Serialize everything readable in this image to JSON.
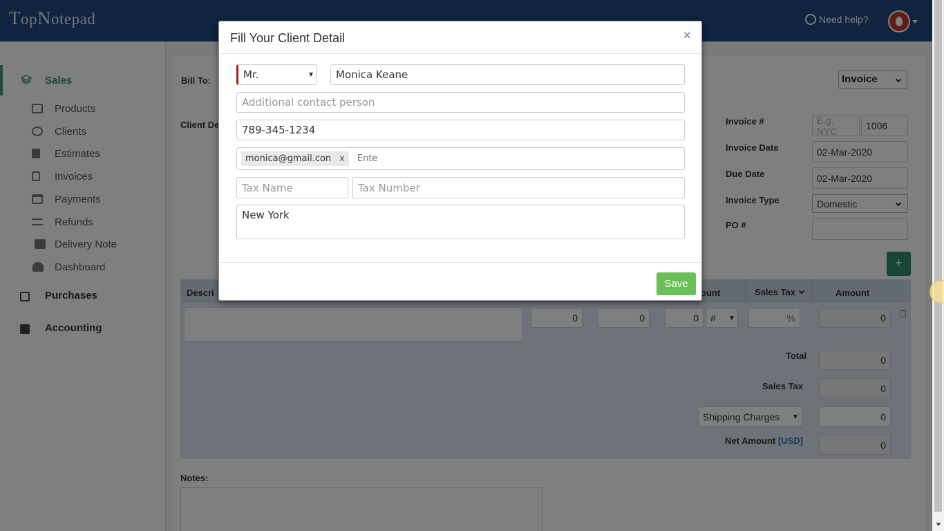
{
  "header": {
    "logo_big": "T",
    "logo_rest": "op",
    "logo_big2": "N",
    "logo_rest2": "otepad",
    "help": "Need help?"
  },
  "sidebar": {
    "sales": "Sales",
    "items": [
      {
        "label": "Products",
        "icon": "cubes-icon"
      },
      {
        "label": "Clients",
        "icon": "user-icon"
      },
      {
        "label": "Estimates",
        "icon": "file-text-icon"
      },
      {
        "label": "Invoices",
        "icon": "file-icon"
      },
      {
        "label": "Payments",
        "icon": "credit-card-icon"
      },
      {
        "label": "Refunds",
        "icon": "exchange-icon"
      },
      {
        "label": "Delivery Note",
        "icon": "truck-icon"
      },
      {
        "label": "Dashboard",
        "icon": "dashboard-icon"
      }
    ],
    "purchases": "Purchases",
    "accounting": "Accounting"
  },
  "main": {
    "bill_to": "Bill To:",
    "client_de": "Client De",
    "doc_type": "Invoice",
    "invoice_no_label": "Invoice #",
    "invoice_prefix_ph": "E.g. NYC",
    "invoice_no": "1006",
    "invoice_date_label": "Invoice Date",
    "invoice_date": "02-Mar-2020",
    "due_date_label": "Due Date",
    "due_date": "02-Mar-2020",
    "invoice_type_label": "Invoice Type",
    "invoice_type": "Domestic",
    "po_label": "PO #",
    "add": "+",
    "col_desc": "Descri",
    "col_ount": "ount",
    "col_sales_tax": "Sales Tax",
    "col_amount": "Amount",
    "row": {
      "v1": "0",
      "v2": "0",
      "v3": "0",
      "hash": "#",
      "pct": "%",
      "amount": "0"
    },
    "total_label": "Total",
    "total": "0",
    "sales_tax_label": "Sales Tax",
    "sales_tax": "0",
    "shipping_label": "Shipping Charges",
    "shipping": "0",
    "net_label": "Net Amount",
    "net_cur": "[USD]",
    "net": "0",
    "notes_label": "Notes:"
  },
  "modal": {
    "title": "Fill Your Client Detail",
    "close": "×",
    "salutation": "Mr.",
    "name": "Monica Keane",
    "contact_ph": "Additional contact person",
    "phone": "789-345-1234",
    "email_tag": "monica@gmail.con",
    "email_tag_x": "x",
    "email_input_ph": "Ente",
    "tax_name_ph": "Tax Name",
    "tax_number_ph": "Tax Number",
    "address": "New York",
    "save": "Save"
  }
}
